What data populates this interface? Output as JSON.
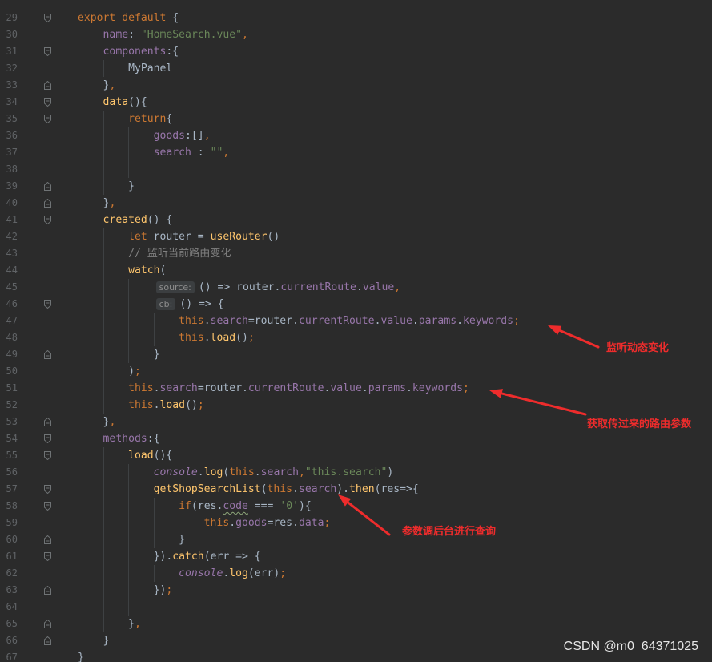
{
  "colors": {
    "background": "#2b2b2b",
    "plain": "#a9b7c6",
    "keyword": "#cc7832",
    "property": "#9876aa",
    "function": "#ffc66d",
    "string": "#6a8759",
    "comment": "#808080",
    "line_number": "#606366",
    "annotation": "#ee2c2c",
    "watermark": "#e6e6e6"
  },
  "editor": {
    "lines": [
      {
        "n": "29",
        "fold": "start",
        "tokens": [
          {
            "t": "export",
            "c": "kw"
          },
          {
            "t": " "
          },
          {
            "t": "default",
            "c": "kw"
          },
          {
            "t": " {"
          }
        ]
      },
      {
        "n": "30",
        "fold": "",
        "tokens": [
          {
            "t": "    "
          },
          {
            "t": "name",
            "c": "prop"
          },
          {
            "t": ": "
          },
          {
            "t": "\"HomeSearch.vue\"",
            "c": "str"
          },
          {
            "t": ",",
            "c": "kw"
          }
        ]
      },
      {
        "n": "31",
        "fold": "start",
        "tokens": [
          {
            "t": "    "
          },
          {
            "t": "components",
            "c": "prop"
          },
          {
            "t": ":{"
          }
        ]
      },
      {
        "n": "32",
        "fold": "",
        "tokens": [
          {
            "t": "        "
          },
          {
            "t": "MyPanel"
          }
        ]
      },
      {
        "n": "33",
        "fold": "end",
        "tokens": [
          {
            "t": "    "
          },
          {
            "t": "}"
          },
          {
            "t": ",",
            "c": "kw"
          }
        ]
      },
      {
        "n": "34",
        "fold": "start",
        "tokens": [
          {
            "t": "    "
          },
          {
            "t": "data",
            "c": "fn"
          },
          {
            "t": "(){"
          }
        ]
      },
      {
        "n": "35",
        "fold": "start",
        "tokens": [
          {
            "t": "        "
          },
          {
            "t": "return",
            "c": "kw"
          },
          {
            "t": "{"
          }
        ]
      },
      {
        "n": "36",
        "fold": "",
        "tokens": [
          {
            "t": "            "
          },
          {
            "t": "goods",
            "c": "prop"
          },
          {
            "t": ":[]"
          },
          {
            "t": ",",
            "c": "kw"
          }
        ]
      },
      {
        "n": "37",
        "fold": "",
        "tokens": [
          {
            "t": "            "
          },
          {
            "t": "search",
            "c": "prop"
          },
          {
            "t": " : "
          },
          {
            "t": "\"\"",
            "c": "str"
          },
          {
            "t": ",",
            "c": "kw"
          }
        ]
      },
      {
        "n": "38",
        "fold": "",
        "tokens": []
      },
      {
        "n": "39",
        "fold": "end",
        "tokens": [
          {
            "t": "        "
          },
          {
            "t": "}"
          }
        ]
      },
      {
        "n": "40",
        "fold": "end",
        "tokens": [
          {
            "t": "    "
          },
          {
            "t": "}"
          },
          {
            "t": ",",
            "c": "kw"
          }
        ]
      },
      {
        "n": "41",
        "fold": "start",
        "tokens": [
          {
            "t": "    "
          },
          {
            "t": "created",
            "c": "fn"
          },
          {
            "t": "() {"
          }
        ]
      },
      {
        "n": "42",
        "fold": "",
        "tokens": [
          {
            "t": "        "
          },
          {
            "t": "let",
            "c": "kw"
          },
          {
            "t": " router = "
          },
          {
            "t": "useRouter",
            "c": "fn"
          },
          {
            "t": "()"
          }
        ]
      },
      {
        "n": "43",
        "fold": "",
        "tokens": [
          {
            "t": "        "
          },
          {
            "t": "// 监听当前路由变化",
            "c": "cmt"
          }
        ]
      },
      {
        "n": "44",
        "fold": "",
        "tokens": [
          {
            "t": "        "
          },
          {
            "t": "watch",
            "c": "fn"
          },
          {
            "t": "("
          }
        ]
      },
      {
        "n": "45",
        "fold": "",
        "tokens": [
          {
            "t": "            "
          },
          {
            "t": "source:",
            "c": "hint"
          },
          {
            "t": "() => router."
          },
          {
            "t": "currentRoute",
            "c": "prop"
          },
          {
            "t": "."
          },
          {
            "t": "value",
            "c": "prop"
          },
          {
            "t": ",",
            "c": "kw"
          }
        ]
      },
      {
        "n": "46",
        "fold": "start",
        "tokens": [
          {
            "t": "            "
          },
          {
            "t": "cb:",
            "c": "hint"
          },
          {
            "t": "() => {"
          }
        ]
      },
      {
        "n": "47",
        "fold": "",
        "tokens": [
          {
            "t": "                "
          },
          {
            "t": "this",
            "c": "kw"
          },
          {
            "t": "."
          },
          {
            "t": "search",
            "c": "prop"
          },
          {
            "t": "=router."
          },
          {
            "t": "currentRoute",
            "c": "prop"
          },
          {
            "t": "."
          },
          {
            "t": "value",
            "c": "prop"
          },
          {
            "t": "."
          },
          {
            "t": "params",
            "c": "prop"
          },
          {
            "t": "."
          },
          {
            "t": "keywords",
            "c": "prop"
          },
          {
            "t": ";",
            "c": "kw"
          }
        ]
      },
      {
        "n": "48",
        "fold": "",
        "tokens": [
          {
            "t": "                "
          },
          {
            "t": "this",
            "c": "kw"
          },
          {
            "t": "."
          },
          {
            "t": "load",
            "c": "fn"
          },
          {
            "t": "()"
          },
          {
            "t": ";",
            "c": "kw"
          }
        ]
      },
      {
        "n": "49",
        "fold": "end",
        "tokens": [
          {
            "t": "            "
          },
          {
            "t": "}"
          }
        ]
      },
      {
        "n": "50",
        "fold": "",
        "tokens": [
          {
            "t": "        "
          },
          {
            "t": ")"
          },
          {
            "t": ";",
            "c": "kw"
          }
        ]
      },
      {
        "n": "51",
        "fold": "",
        "tokens": [
          {
            "t": "        "
          },
          {
            "t": "this",
            "c": "kw"
          },
          {
            "t": "."
          },
          {
            "t": "search",
            "c": "prop"
          },
          {
            "t": "=router."
          },
          {
            "t": "currentRoute",
            "c": "prop"
          },
          {
            "t": "."
          },
          {
            "t": "value",
            "c": "prop"
          },
          {
            "t": "."
          },
          {
            "t": "params",
            "c": "prop"
          },
          {
            "t": "."
          },
          {
            "t": "keywords",
            "c": "prop"
          },
          {
            "t": ";",
            "c": "kw"
          }
        ]
      },
      {
        "n": "52",
        "fold": "",
        "tokens": [
          {
            "t": "        "
          },
          {
            "t": "this",
            "c": "kw"
          },
          {
            "t": "."
          },
          {
            "t": "load",
            "c": "fn"
          },
          {
            "t": "()"
          },
          {
            "t": ";",
            "c": "kw"
          }
        ]
      },
      {
        "n": "53",
        "fold": "end",
        "tokens": [
          {
            "t": "    "
          },
          {
            "t": "}"
          },
          {
            "t": ",",
            "c": "kw"
          }
        ]
      },
      {
        "n": "54",
        "fold": "start",
        "tokens": [
          {
            "t": "    "
          },
          {
            "t": "methods",
            "c": "prop"
          },
          {
            "t": ":{"
          }
        ]
      },
      {
        "n": "55",
        "fold": "start",
        "tokens": [
          {
            "t": "        "
          },
          {
            "t": "load",
            "c": "fn"
          },
          {
            "t": "(){"
          }
        ]
      },
      {
        "n": "56",
        "fold": "",
        "tokens": [
          {
            "t": "            "
          },
          {
            "t": "console",
            "c": "glob"
          },
          {
            "t": "."
          },
          {
            "t": "log",
            "c": "fn"
          },
          {
            "t": "("
          },
          {
            "t": "this",
            "c": "kw"
          },
          {
            "t": "."
          },
          {
            "t": "search",
            "c": "prop"
          },
          {
            "t": ",",
            "c": "kw"
          },
          {
            "t": "\"this.search\"",
            "c": "str"
          },
          {
            "t": ")"
          }
        ]
      },
      {
        "n": "57",
        "fold": "start",
        "tokens": [
          {
            "t": "            "
          },
          {
            "t": "getShopSearchList",
            "c": "fn"
          },
          {
            "t": "("
          },
          {
            "t": "this",
            "c": "kw"
          },
          {
            "t": "."
          },
          {
            "t": "search",
            "c": "prop"
          },
          {
            "t": ")."
          },
          {
            "t": "then",
            "c": "fn"
          },
          {
            "t": "(res=>{"
          }
        ]
      },
      {
        "n": "58",
        "fold": "start",
        "tokens": [
          {
            "t": "                "
          },
          {
            "t": "if",
            "c": "kw"
          },
          {
            "t": "(res."
          },
          {
            "t": "code",
            "c": "prop squiggle"
          },
          {
            "t": " === "
          },
          {
            "t": "'0'",
            "c": "str"
          },
          {
            "t": "){"
          }
        ]
      },
      {
        "n": "59",
        "fold": "",
        "tokens": [
          {
            "t": "                    "
          },
          {
            "t": "this",
            "c": "kw"
          },
          {
            "t": "."
          },
          {
            "t": "goods",
            "c": "prop"
          },
          {
            "t": "=res."
          },
          {
            "t": "data",
            "c": "prop"
          },
          {
            "t": ";",
            "c": "kw"
          }
        ]
      },
      {
        "n": "60",
        "fold": "end",
        "tokens": [
          {
            "t": "                "
          },
          {
            "t": "}"
          }
        ]
      },
      {
        "n": "61",
        "fold": "start",
        "tokens": [
          {
            "t": "            "
          },
          {
            "t": "})."
          },
          {
            "t": "catch",
            "c": "fn"
          },
          {
            "t": "(err => {"
          }
        ]
      },
      {
        "n": "62",
        "fold": "",
        "tokens": [
          {
            "t": "                "
          },
          {
            "t": "console",
            "c": "glob"
          },
          {
            "t": "."
          },
          {
            "t": "log",
            "c": "fn"
          },
          {
            "t": "(err)"
          },
          {
            "t": ";",
            "c": "kw"
          }
        ]
      },
      {
        "n": "63",
        "fold": "end",
        "tokens": [
          {
            "t": "            "
          },
          {
            "t": "})"
          },
          {
            "t": ";",
            "c": "kw"
          }
        ]
      },
      {
        "n": "64",
        "fold": "",
        "tokens": []
      },
      {
        "n": "65",
        "fold": "end",
        "tokens": [
          {
            "t": "        "
          },
          {
            "t": "}"
          },
          {
            "t": ",",
            "c": "kw"
          }
        ]
      },
      {
        "n": "66",
        "fold": "end",
        "tokens": [
          {
            "t": "    "
          },
          {
            "t": "}"
          }
        ]
      },
      {
        "n": "67",
        "fold": "",
        "tokens": [
          {
            "t": "}"
          }
        ]
      }
    ]
  },
  "annotations": [
    {
      "label": "监听动态变化"
    },
    {
      "label": "获取传过来的路由参数"
    },
    {
      "label": "参数调后台进行查询"
    }
  ],
  "watermark": "CSDN @m0_64371025"
}
